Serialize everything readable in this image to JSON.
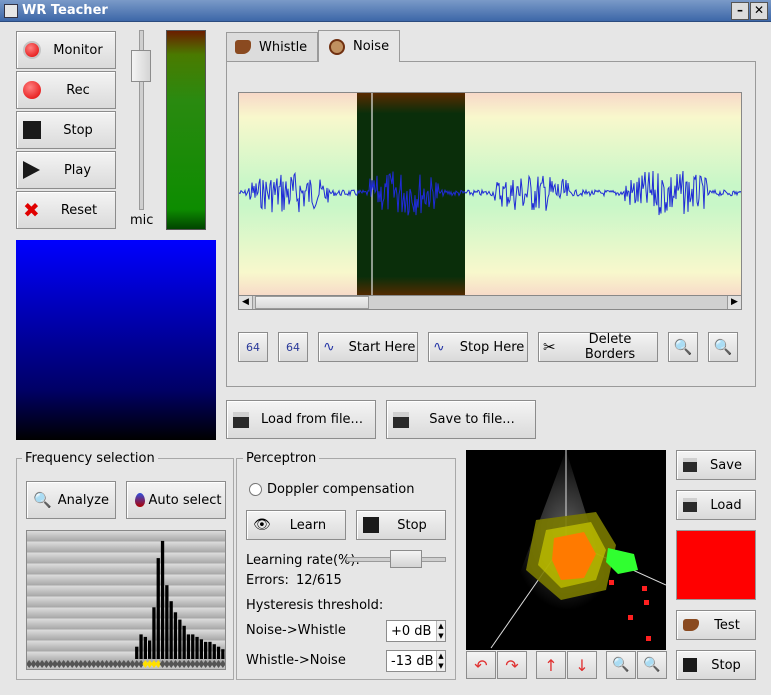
{
  "window": {
    "title": "WR Teacher"
  },
  "recorder": {
    "buttons": [
      "Monitor",
      "Rec",
      "Stop",
      "Play",
      "Reset"
    ],
    "mic_label": "mic"
  },
  "tabs": [
    {
      "label": "Whistle"
    },
    {
      "label": "Noise"
    }
  ],
  "waveform_toolbar": {
    "zoom_out_64": "64",
    "zoom_in_64": "64",
    "start_here": "Start Here",
    "stop_here": "Stop Here",
    "delete_borders": "Delete Borders"
  },
  "file": {
    "load": "Load from file...",
    "save": "Save to file..."
  },
  "frequency": {
    "title": "Frequency selection",
    "analyze": "Analyze",
    "auto_select": "Auto select",
    "bar_values": [
      0,
      0,
      0,
      0,
      0,
      0,
      0,
      0,
      0,
      0,
      0,
      0,
      0,
      0,
      0,
      0,
      0,
      0,
      0,
      0,
      0,
      0,
      0,
      0,
      0,
      0.1,
      0.2,
      0.18,
      0.15,
      0.42,
      0.82,
      0.96,
      0.6,
      0.47,
      0.38,
      0.32,
      0.27,
      0.2,
      0.2,
      0.18,
      0.16,
      0.14,
      0.14,
      0.12,
      0.1,
      0.08
    ]
  },
  "perceptron": {
    "title": "Perceptron",
    "doppler": "Doppler compensation",
    "learn": "Learn",
    "stop": "Stop",
    "learning_rate_label": "Learning rate(%):",
    "errors_label": "Errors:",
    "errors_value": "12/615",
    "hysteresis_label": "Hysteresis threshold:",
    "noise_to_whistle_label": "Noise->Whistle",
    "noise_to_whistle_value": "+0 dB",
    "whistle_to_noise_label": "Whistle->Noise",
    "whistle_to_noise_value": "-13 dB"
  },
  "right_panel": {
    "save": "Save",
    "load": "Load",
    "test": "Test",
    "stop": "Stop"
  },
  "colors": {
    "status_indicator": "#ff0000",
    "accent_wave": "#1f2bd6"
  }
}
